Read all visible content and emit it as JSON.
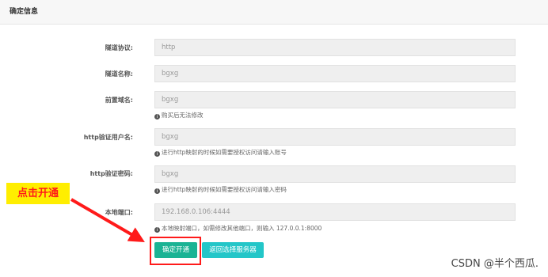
{
  "panel": {
    "title": "确定信息"
  },
  "form": {
    "protocol": {
      "label": "隧道协议:",
      "value": "http"
    },
    "name": {
      "label": "隧道名称:",
      "value": "bgxg"
    },
    "prefix": {
      "label": "前置域名:",
      "value": "bgxg",
      "help": "购买后无法修改"
    },
    "http_user": {
      "label": "http验证用户名:",
      "value": "bgxg",
      "help": "进行http映射的时候如需要授权访问请输入账号"
    },
    "http_pass": {
      "label": "http验证密码:",
      "value": "bgxg",
      "help": "进行http映射的时候如需要授权访问请输入密码"
    },
    "local_port": {
      "label": "本地端口:",
      "value": "192.168.0.106:4444",
      "help": "本地映射端口，如需修改其他端口，则输入 127.0.0.1:8000"
    }
  },
  "buttons": {
    "confirm": "确定开通",
    "back": "返回选择服务器"
  },
  "annotation": {
    "callout": "点击开通"
  },
  "watermark": "CSDN @半个西瓜.",
  "colors": {
    "confirm": "#1ab394",
    "back": "#23c6c8",
    "annotation": "#ff1a1a",
    "callout_bg": "#ffee00"
  }
}
